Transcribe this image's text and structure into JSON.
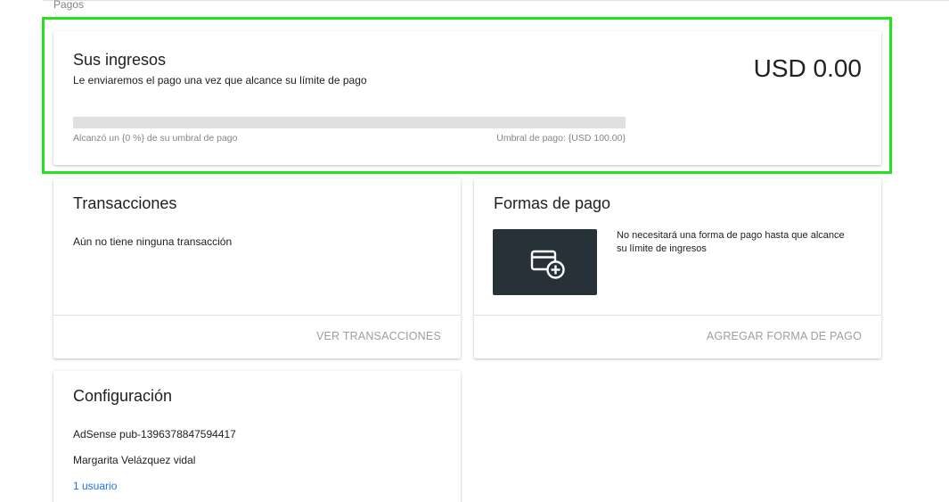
{
  "section": {
    "label": "Pagos"
  },
  "earnings": {
    "title": "Sus ingresos",
    "subtitle": "Le enviaremos el pago una vez que alcance su límite de pago",
    "amount": "USD 0.00",
    "progress_fraction": 0,
    "progress_left": "Alcanzó un {0 %} de su umbral de pago",
    "progress_right": "Umbral de pago: {USD 100.00}"
  },
  "transactions": {
    "title": "Transacciones",
    "empty_text": "Aún no tiene ninguna transacción",
    "action": "VER TRANSACCIONES"
  },
  "payments": {
    "title": "Formas de pago",
    "info": "No necesitará una forma de pago hasta que alcance su límite de ingresos",
    "action": "AGREGAR FORMA DE PAGO",
    "icon": "add-card-icon"
  },
  "config": {
    "title": "Configuración",
    "publisher_id": "AdSense pub-1396378847594417",
    "owner": "Margarita Velázquez vidal",
    "users_link": "1 usuario"
  },
  "colors": {
    "highlight": "#22e31c",
    "link": "#1a73e8",
    "tile": "#263238"
  }
}
